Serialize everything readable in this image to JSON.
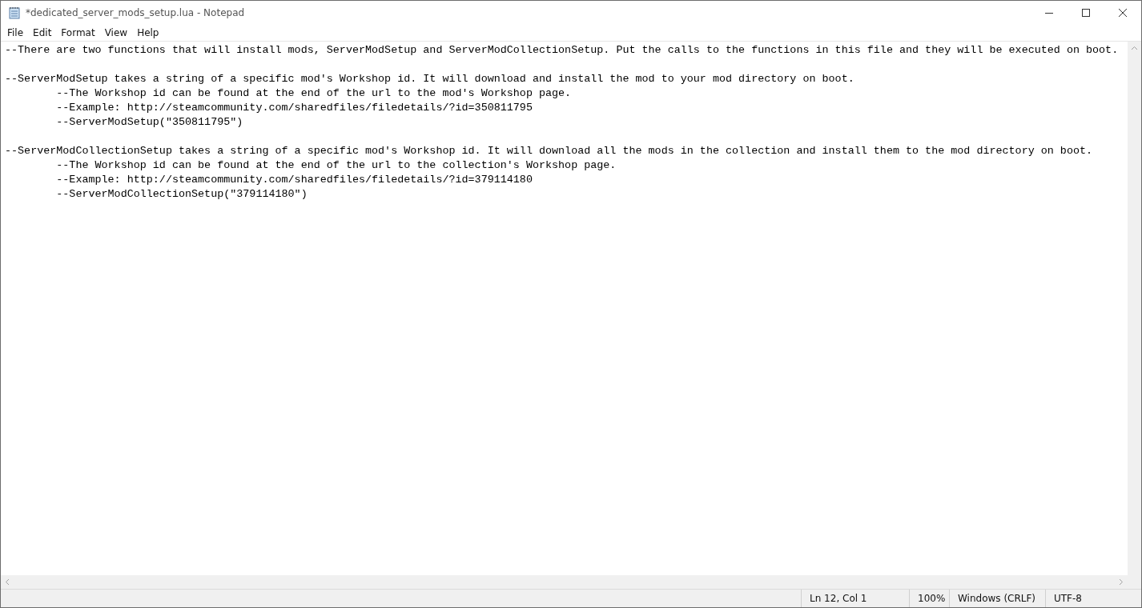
{
  "window": {
    "title": "*dedicated_server_mods_setup.lua - Notepad"
  },
  "menu": [
    "File",
    "Edit",
    "Format",
    "View",
    "Help"
  ],
  "editor": {
    "paragraphs": [
      [
        "--There are two functions that will install mods, ServerModSetup and ServerModCollectionSetup. Put the calls to the functions in this file and they will be executed on boot."
      ],
      [
        "--ServerModSetup takes a string of a specific mod's Workshop id. It will download and install the mod to your mod directory on boot.",
        "\t--The Workshop id can be found at the end of the url to the mod's Workshop page.",
        "\t--Example: http://steamcommunity.com/sharedfiles/filedetails/?id=350811795",
        "\t--ServerModSetup(\"350811795\")"
      ],
      [
        "--ServerModCollectionSetup takes a string of a specific mod's Workshop id. It will download all the mods in the collection and install them to the mod directory on boot.",
        "\t--The Workshop id can be found at the end of the url to the collection's Workshop page.",
        "\t--Example: http://steamcommunity.com/sharedfiles/filedetails/?id=379114180",
        "\t--ServerModCollectionSetup(\"379114180\")"
      ]
    ]
  },
  "status_bar": {
    "position": "Ln 12, Col 1",
    "zoom": "100%",
    "line_ending": "Windows (CRLF)",
    "encoding": "UTF-8"
  }
}
